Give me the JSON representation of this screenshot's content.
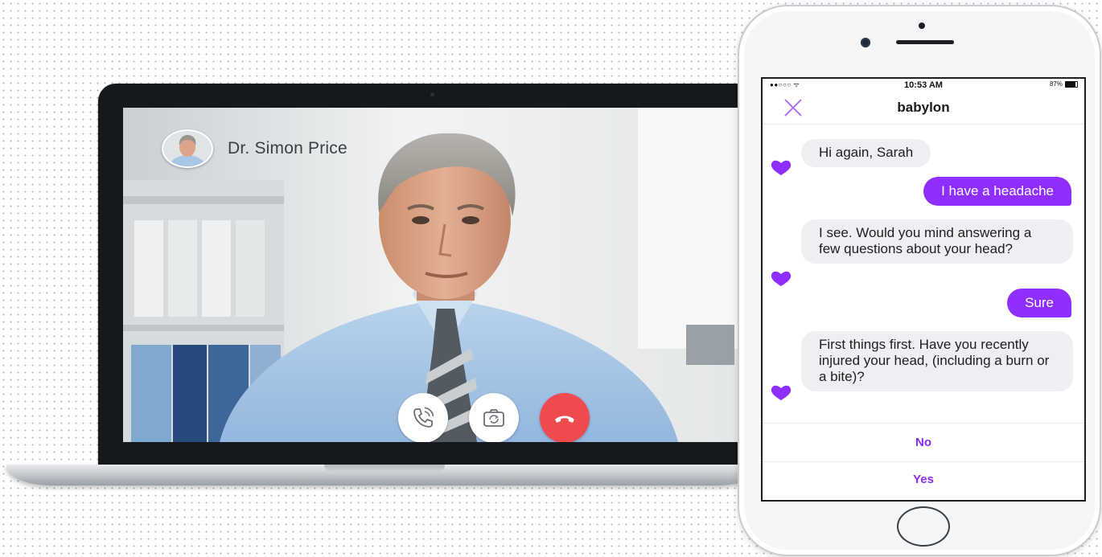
{
  "video_call": {
    "caller_name": "Dr. Simon Price",
    "controls": [
      {
        "icon": "phone-wave-icon",
        "color": "#ffffff"
      },
      {
        "icon": "camera-switch-icon",
        "color": "#ffffff"
      },
      {
        "icon": "end-call-icon",
        "color": "#ef4b4f"
      }
    ]
  },
  "phone": {
    "status_bar": {
      "signal": "●●○○○ ᯤ",
      "time": "10:53 AM",
      "battery": "87%"
    },
    "app_title": "babylon",
    "accent_color": "#8e2fff",
    "messages": [
      {
        "sender": "bot",
        "text": "Hi again, Sarah"
      },
      {
        "sender": "user",
        "text": "I have a headache"
      },
      {
        "sender": "bot",
        "text": "I see. Would you mind answering a few questions about your head?"
      },
      {
        "sender": "user",
        "text": "Sure"
      },
      {
        "sender": "bot",
        "text": "First things first. Have you recently injured your head, (including a burn or a bite)?"
      }
    ],
    "replies": [
      "No",
      "Yes"
    ]
  }
}
